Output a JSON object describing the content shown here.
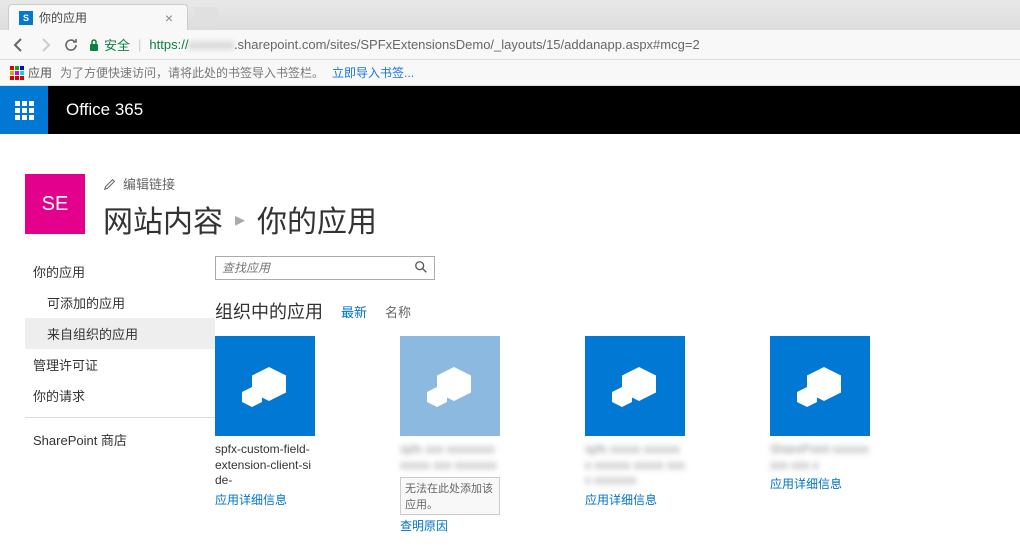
{
  "browser": {
    "tab_title": "你的应用",
    "url_protocol": "https://",
    "url_blurred_domain": "xxxxxxx",
    "url_path": ".sharepoint.com/sites/SPFxExtensionsDemo/_layouts/15/addanapp.aspx#mcg=2",
    "secure_label": "安全",
    "apps_button": "应用",
    "bookmark_hint": "为了方便快速访问，请将此处的书签导入书签栏。",
    "bookmark_import": "立即导入书签..."
  },
  "o365": {
    "title": "Office 365"
  },
  "header": {
    "site_logo_text": "SE",
    "edit_links_label": "编辑链接",
    "breadcrumb_root": "网站内容",
    "breadcrumb_current": "你的应用"
  },
  "sidebar": {
    "items": [
      {
        "label": "你的应用",
        "indent": false,
        "active": false
      },
      {
        "label": "可添加的应用",
        "indent": true,
        "active": false
      },
      {
        "label": "来自组织的应用",
        "indent": true,
        "active": true
      },
      {
        "label": "管理许可证",
        "indent": false,
        "active": false
      },
      {
        "label": "你的请求",
        "indent": false,
        "active": false
      }
    ],
    "store_label": "SharePoint 商店"
  },
  "search": {
    "placeholder": "查找应用"
  },
  "section": {
    "title": "组织中的应用",
    "sort_newest": "最新",
    "sort_name": "名称"
  },
  "apps": [
    {
      "name": "spfx-custom-field-extension-client-side-",
      "blurred": false,
      "faded": false,
      "detail_link": "应用详细信息",
      "disabled_msg": null,
      "reason_link": null
    },
    {
      "name": "spfx xxx xxxxxxxx xxxxx xxx xxxxxxx",
      "blurred": true,
      "faded": true,
      "detail_link": null,
      "disabled_msg": "无法在此处添加该应用。",
      "reason_link": "查明原因"
    },
    {
      "name": "spfx xxxxx xxxxxxx xxxxxx xxxxx xxxx xxxxxxx",
      "blurred": true,
      "faded": false,
      "detail_link": "应用详细信息",
      "disabled_msg": null,
      "reason_link": null
    },
    {
      "name": "SharePoint xxxxxxxxx xxx x",
      "blurred": true,
      "faded": false,
      "detail_link": "应用详细信息",
      "disabled_msg": null,
      "reason_link": null
    }
  ]
}
